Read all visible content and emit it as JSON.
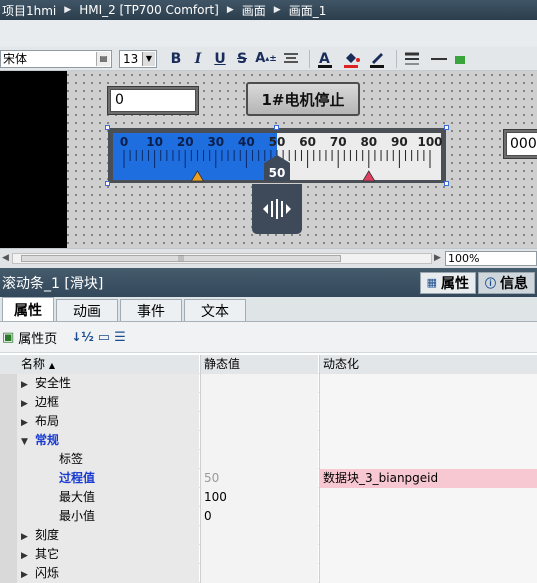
{
  "breadcrumb": [
    "项目1hmi",
    "HMI_2 [TP700 Comfort]",
    "画面",
    "画面_1"
  ],
  "toolbar": {
    "font": "宋体",
    "size": "13",
    "bold": "B",
    "italic": "I",
    "underline": "U",
    "strike": "S"
  },
  "canvas": {
    "io_left_value": "0",
    "stop_button_label": "1#电机停止",
    "io_right_value": "000",
    "slider": {
      "min": 0,
      "max": 100,
      "value": 50,
      "ticks": [
        "0",
        "10",
        "20",
        "30",
        "40",
        "50",
        "60",
        "70",
        "80",
        "90",
        "100"
      ],
      "value_label": "50",
      "fill_color": "#1f6ee0",
      "marker_orange_at": 24,
      "marker_red_at": 80
    }
  },
  "zoom": "100%",
  "inspector": {
    "title": "滚动条_1 [滑块]",
    "tab_properties": "属性",
    "tab_info": "信息"
  },
  "subtabs": [
    "属性",
    "动画",
    "事件",
    "文本"
  ],
  "prop_toolbar": {
    "label": "属性页"
  },
  "table": {
    "headers": {
      "name": "名称",
      "static": "静态值",
      "dynamic": "动态化"
    },
    "rows": [
      {
        "name": "安全性",
        "type": "group",
        "expanded": false
      },
      {
        "name": "边框",
        "type": "group",
        "expanded": false
      },
      {
        "name": "布局",
        "type": "group",
        "expanded": false
      },
      {
        "name": "常规",
        "type": "group",
        "expanded": true
      },
      {
        "name": "标签",
        "type": "item"
      },
      {
        "name": "过程值",
        "type": "item",
        "static": "50",
        "dynamic": "数据块_3_bianpgeid"
      },
      {
        "name": "最大值",
        "type": "item",
        "static": "100"
      },
      {
        "name": "最小值",
        "type": "item",
        "static": "0"
      },
      {
        "name": "刻度",
        "type": "group",
        "expanded": false
      },
      {
        "name": "其它",
        "type": "group",
        "expanded": false
      },
      {
        "name": "闪烁",
        "type": "group",
        "expanded": false
      }
    ]
  },
  "icons": [
    "chevron-right-icon",
    "bold-icon",
    "italic-icon",
    "underline-icon",
    "strike-icon",
    "text-color-icon",
    "fill-color-icon",
    "line-color-icon",
    "align-icon",
    "sort-icon",
    "properties-page-icon",
    "info-icon",
    "slider-handle-icon"
  ]
}
